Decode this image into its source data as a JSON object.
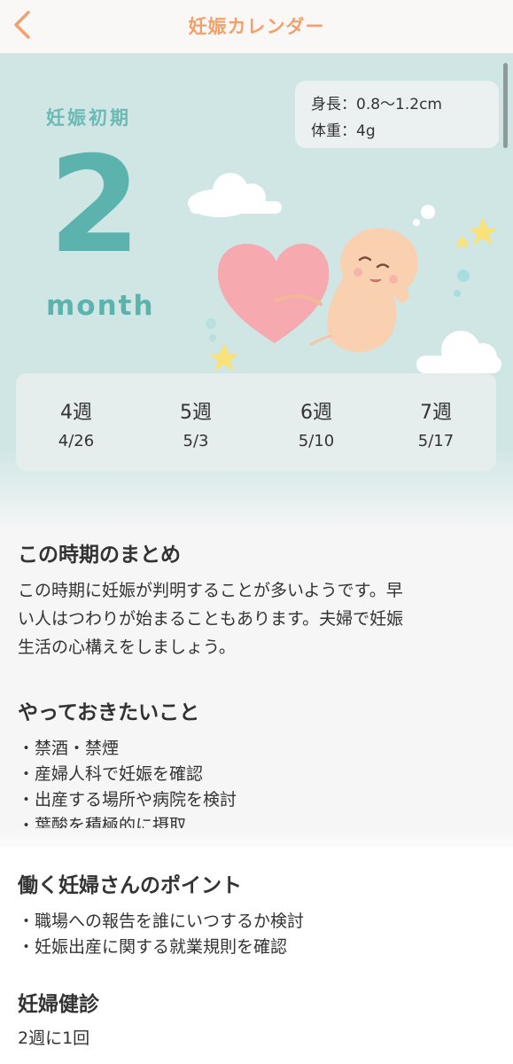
{
  "navbar": {
    "title": "妊娠カレンダー"
  },
  "hero": {
    "stage": "妊娠初期",
    "month_number": "2",
    "month_unit": "month",
    "size": {
      "height": "身長：0.8〜1.2cm",
      "weight": "体重：4g"
    },
    "weeks": [
      {
        "week": "4週",
        "date": "4/26"
      },
      {
        "week": "5週",
        "date": "5/3"
      },
      {
        "week": "6週",
        "date": "5/10"
      },
      {
        "week": "7週",
        "date": "5/17"
      }
    ]
  },
  "summary": {
    "title": "この時期のまとめ",
    "lines": [
      "この時期に妊娠が判明することが多いようです。早",
      "い人はつわりが始まることもあります。夫婦で妊娠",
      "生活の心構えをしましょう。"
    ]
  },
  "todo": {
    "title": "やっておきたいこと",
    "items": [
      "・禁酒・禁煙",
      "・産婦人科で妊娠を確認",
      "・出産する場所や病院を検討",
      "・葉酸を積極的に摂取"
    ]
  },
  "work": {
    "title": "働く妊婦さんのポイント",
    "items": [
      "・職場への報告を誰にいつするか検討",
      "・妊娠出産に関する就業規則を確認"
    ]
  },
  "checkup": {
    "title": "妊婦健診",
    "value": "2週に1回"
  },
  "colors": {
    "accent": "#f4a06b",
    "teal": "#5cb3ad",
    "hero_bg": "#cfe6e5",
    "heart": "#f6a9ae",
    "baby": "#f9d1b1",
    "star": "#f9e27a"
  }
}
